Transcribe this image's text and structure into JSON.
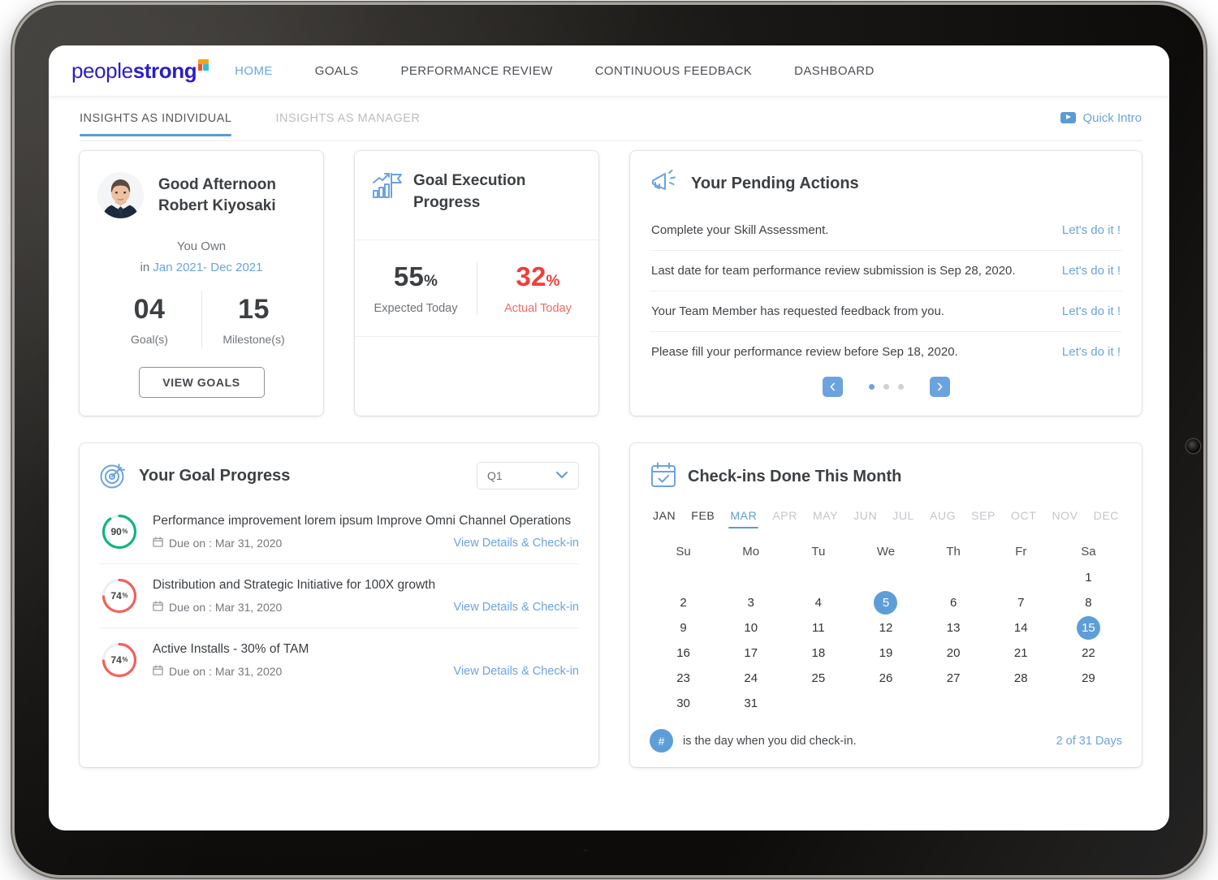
{
  "brand": {
    "name_light": "people",
    "name_bold": "strong"
  },
  "nav": {
    "items": [
      {
        "label": "HOME",
        "active": true
      },
      {
        "label": "GOALS",
        "active": false
      },
      {
        "label": "PERFORMANCE REVIEW",
        "active": false
      },
      {
        "label": "CONTINUOUS FEEDBACK",
        "active": false
      },
      {
        "label": "DASHBOARD",
        "active": false
      }
    ]
  },
  "subtabs": {
    "items": [
      {
        "label": "INSIGHTS AS INDIVIDUAL",
        "active": true
      },
      {
        "label": "INSIGHTS AS MANAGER",
        "active": false
      }
    ],
    "quick_intro": "Quick Intro"
  },
  "greeting": {
    "salutation": "Good Afternoon",
    "user_name": "Robert Kiyosaki",
    "you_own": "You Own",
    "period_prefix": "in",
    "period": "Jan 2021- Dec 2021",
    "stats": [
      {
        "value": "04",
        "label": "Goal(s)"
      },
      {
        "value": "15",
        "label": "Milestone(s)"
      }
    ],
    "view_goals_label": "VIEW GOALS"
  },
  "goal_execution": {
    "title_line1": "Goal Execution",
    "title_line2": "Progress",
    "expected": {
      "value": "55",
      "unit": "%",
      "caption": "Expected Today"
    },
    "actual": {
      "value": "32",
      "unit": "%",
      "caption": "Actual Today",
      "color": "#ef3e36"
    }
  },
  "pending_actions": {
    "title": "Your Pending Actions",
    "items": [
      {
        "text": "Complete your Skill Assessment.",
        "action": "Let's do it !"
      },
      {
        "text": "Last date for team performance review submission is Sep 28, 2020.",
        "action": "Let's do it !"
      },
      {
        "text": "Your Team Member has requested feedback from you.",
        "action": "Let's do it !"
      },
      {
        "text": "Please fill your performance review before Sep 18, 2020.",
        "action": "Let's do it !"
      }
    ],
    "pager": {
      "dots": 3,
      "active_index": 0
    }
  },
  "goal_progress": {
    "title": "Your Goal Progress",
    "quarter_selected": "Q1",
    "goals": [
      {
        "title": "Performance improvement lorem ipsum Improve Omni Channel Operations",
        "percent": 90,
        "percent_label": "90",
        "percent_unit": "%",
        "due_label": "Due on : Mar 31, 2020",
        "link": "View Details & Check-in",
        "color": "#13b57f"
      },
      {
        "title": "Distribution and Strategic Initiative for 100X growth",
        "percent": 74,
        "percent_label": "74",
        "percent_unit": "%",
        "due_label": "Due on : Mar 31, 2020",
        "link": "View Details & Check-in",
        "color": "#f4615c"
      },
      {
        "title": "Active Installs - 30% of TAM",
        "percent": 74,
        "percent_label": "74",
        "percent_unit": "%",
        "due_label": "Due on : Mar 31, 2020",
        "link": "View Details & Check-in",
        "color": "#f4615c"
      }
    ]
  },
  "checkins": {
    "title": "Check-ins Done This Month",
    "months": [
      {
        "label": "JAN",
        "state": "past"
      },
      {
        "label": "FEB",
        "state": "past"
      },
      {
        "label": "MAR",
        "state": "active"
      },
      {
        "label": "APR",
        "state": "future"
      },
      {
        "label": "MAY",
        "state": "future"
      },
      {
        "label": "JUN",
        "state": "future"
      },
      {
        "label": "JUL",
        "state": "future"
      },
      {
        "label": "AUG",
        "state": "future"
      },
      {
        "label": "SEP",
        "state": "future"
      },
      {
        "label": "OCT",
        "state": "future"
      },
      {
        "label": "NOV",
        "state": "future"
      },
      {
        "label": "DEC",
        "state": "future"
      }
    ],
    "day_headers": [
      "Su",
      "Mo",
      "Tu",
      "We",
      "Th",
      "Fr",
      "Sa"
    ],
    "lead_blanks": 6,
    "days_in_month": 31,
    "checked_days": [
      5,
      15
    ],
    "legend_badge": "#",
    "legend_text": "is the day when you did check-in.",
    "count_done": "2",
    "count_rest": " of 31 Days"
  }
}
